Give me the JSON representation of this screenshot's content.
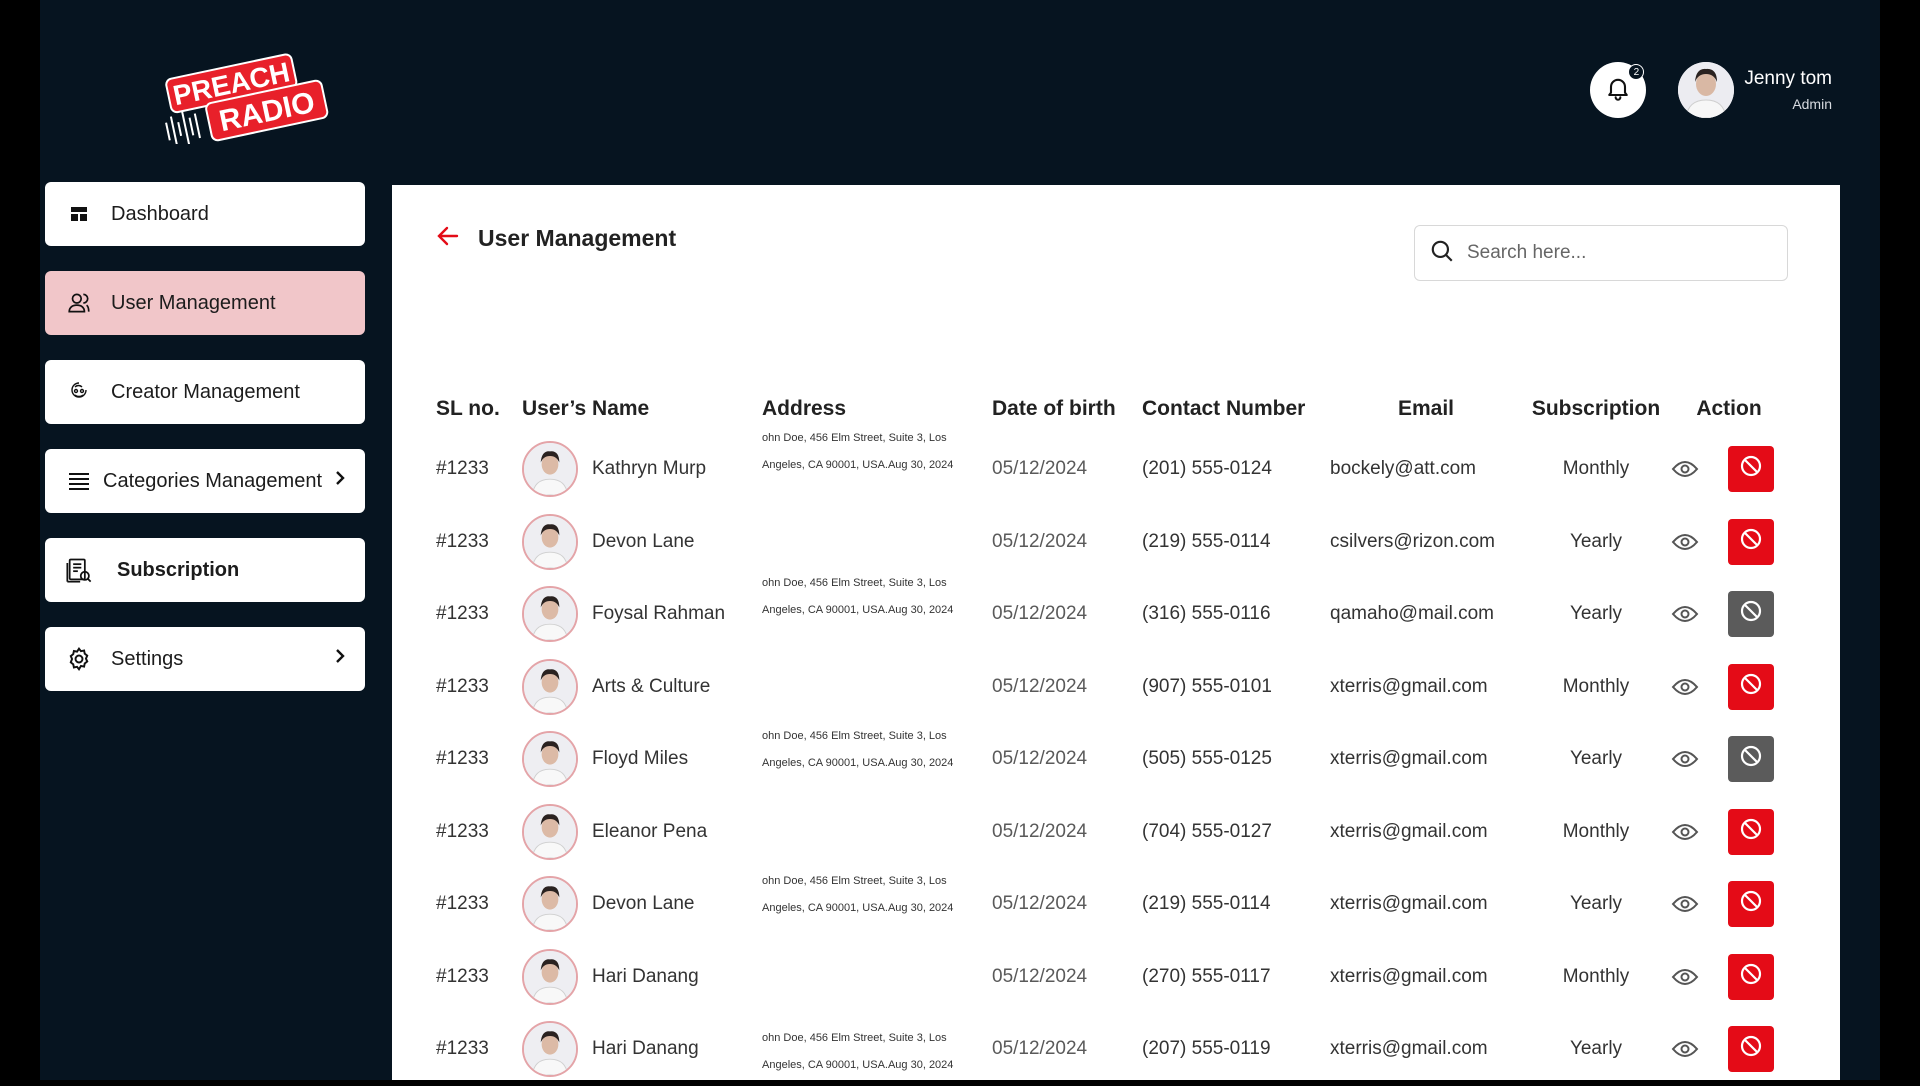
{
  "brand": {
    "logo_line1": "PREACH",
    "logo_line2": "RADIO"
  },
  "topbar": {
    "notification_count": "2",
    "user_name": "Jenny tom",
    "user_role": "Admin"
  },
  "sidebar": {
    "items": [
      {
        "label": "Dashboard",
        "icon": "dashboard-icon"
      },
      {
        "label": "User Management",
        "icon": "users-icon"
      },
      {
        "label": "Creator Management",
        "icon": "creator-icon"
      },
      {
        "label": "Categories Management",
        "icon": "list-icon"
      },
      {
        "label": "Subscription",
        "icon": "subscription-icon"
      },
      {
        "label": "Settings",
        "icon": "gear-icon"
      }
    ]
  },
  "page": {
    "title": "User Management",
    "search_placeholder": "Search here..."
  },
  "table": {
    "headers": [
      "SL no.",
      "User’s Name",
      "Address",
      "Date of birth",
      "Contact Number",
      "Email",
      "Subscription",
      "Action"
    ],
    "rows": [
      {
        "sl": "#1233",
        "name": "Kathryn Murp",
        "address": "ohn Doe, 456 Elm Street, Suite 3, Los Angeles, CA 90001, USA.Aug 30, 2024",
        "dob": "05/12/2024",
        "contact": "(201) 555-0124",
        "email": "bockely@att.com",
        "subscription": "Monthly",
        "blocked": false
      },
      {
        "sl": "#1233",
        "name": "Devon Lane",
        "address": "",
        "dob": "05/12/2024",
        "contact": "(219) 555-0114",
        "email": "csilvers@rizon.com",
        "subscription": "Yearly",
        "blocked": false
      },
      {
        "sl": "#1233",
        "name": "Foysal Rahman",
        "address": "ohn Doe, 456 Elm Street, Suite 3, Los Angeles, CA 90001, USA.Aug 30, 2024",
        "dob": "05/12/2024",
        "contact": "(316) 555-0116",
        "email": "qamaho@mail.com",
        "subscription": "Yearly",
        "blocked": true
      },
      {
        "sl": "#1233",
        "name": "Arts & Culture",
        "address": "",
        "dob": "05/12/2024",
        "contact": "(907) 555-0101",
        "email": "xterris@gmail.com",
        "subscription": "Monthly",
        "blocked": false
      },
      {
        "sl": "#1233",
        "name": "Floyd Miles",
        "address": "ohn Doe, 456 Elm Street, Suite 3, Los Angeles, CA 90001, USA.Aug 30, 2024",
        "dob": "05/12/2024",
        "contact": "(505) 555-0125",
        "email": "xterris@gmail.com",
        "subscription": "Yearly",
        "blocked": true
      },
      {
        "sl": "#1233",
        "name": "Eleanor Pena",
        "address": "",
        "dob": "05/12/2024",
        "contact": "(704) 555-0127",
        "email": "xterris@gmail.com",
        "subscription": "Monthly",
        "blocked": false
      },
      {
        "sl": "#1233",
        "name": "Devon Lane",
        "address": "ohn Doe, 456 Elm Street, Suite 3, Los Angeles, CA 90001, USA.Aug 30, 2024",
        "dob": "05/12/2024",
        "contact": "(219) 555-0114",
        "email": "xterris@gmail.com",
        "subscription": "Yearly",
        "blocked": false
      },
      {
        "sl": "#1233",
        "name": "Hari Danang",
        "address": "",
        "dob": "05/12/2024",
        "contact": "(270) 555-0117",
        "email": "xterris@gmail.com",
        "subscription": "Monthly",
        "blocked": false
      },
      {
        "sl": "#1233",
        "name": "Hari Danang",
        "address": "ohn Doe, 456 Elm Street, Suite 3, Los Angeles, CA 90001, USA.Aug 30, 2024",
        "dob": "05/12/2024",
        "contact": "(207) 555-0119",
        "email": "xterris@gmail.com",
        "subscription": "Yearly",
        "blocked": false
      }
    ]
  },
  "colors": {
    "accent": "#e40b17",
    "sidebar_active": "#f1c6c9",
    "dark_bg": "#061420",
    "blocked_grey": "#5b5b5b"
  }
}
